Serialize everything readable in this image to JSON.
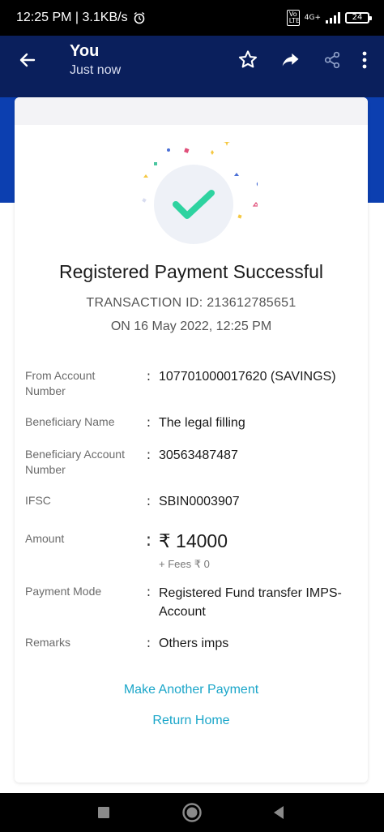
{
  "status_bar": {
    "time_speed": "12:25 PM | 3.1KB/s",
    "volte": "Vo LTE",
    "network": "4G+",
    "battery": "24"
  },
  "header": {
    "title": "You",
    "subtitle": "Just now"
  },
  "receipt": {
    "title": "Registered Payment Successful",
    "transaction_id": "TRANSACTION ID: 213612785651",
    "date": "ON 16 May 2022, 12:25 PM",
    "details": [
      {
        "label": "From Account Number",
        "value": "107701000017620 (SAVINGS)"
      },
      {
        "label": "Beneficiary Name",
        "value": "The legal filling"
      },
      {
        "label": "Beneficiary Account Number",
        "value": "30563487487"
      },
      {
        "label": "IFSC",
        "value": "SBIN0003907"
      },
      {
        "label": "Amount",
        "value": "₹ 14000",
        "fees": "+ Fees ₹ 0"
      },
      {
        "label": "Payment Mode",
        "value": "Registered Fund transfer IMPS-Account"
      },
      {
        "label": "Remarks",
        "value": "Others imps"
      }
    ],
    "separator": ":"
  },
  "actions": {
    "make_another": "Make Another Payment",
    "return_home": "Return Home"
  },
  "colors": {
    "header_bg": "#0a1f5c",
    "band_bg": "#0c3fb0",
    "success_green": "#2ed3a0",
    "link": "#1ba6c9"
  },
  "icons": [
    "back-arrow-icon",
    "star-icon",
    "share-icon",
    "share-nodes-icon",
    "more-vert-icon",
    "checkmark-icon",
    "recents-icon",
    "home-icon",
    "back-triangle-icon"
  ]
}
